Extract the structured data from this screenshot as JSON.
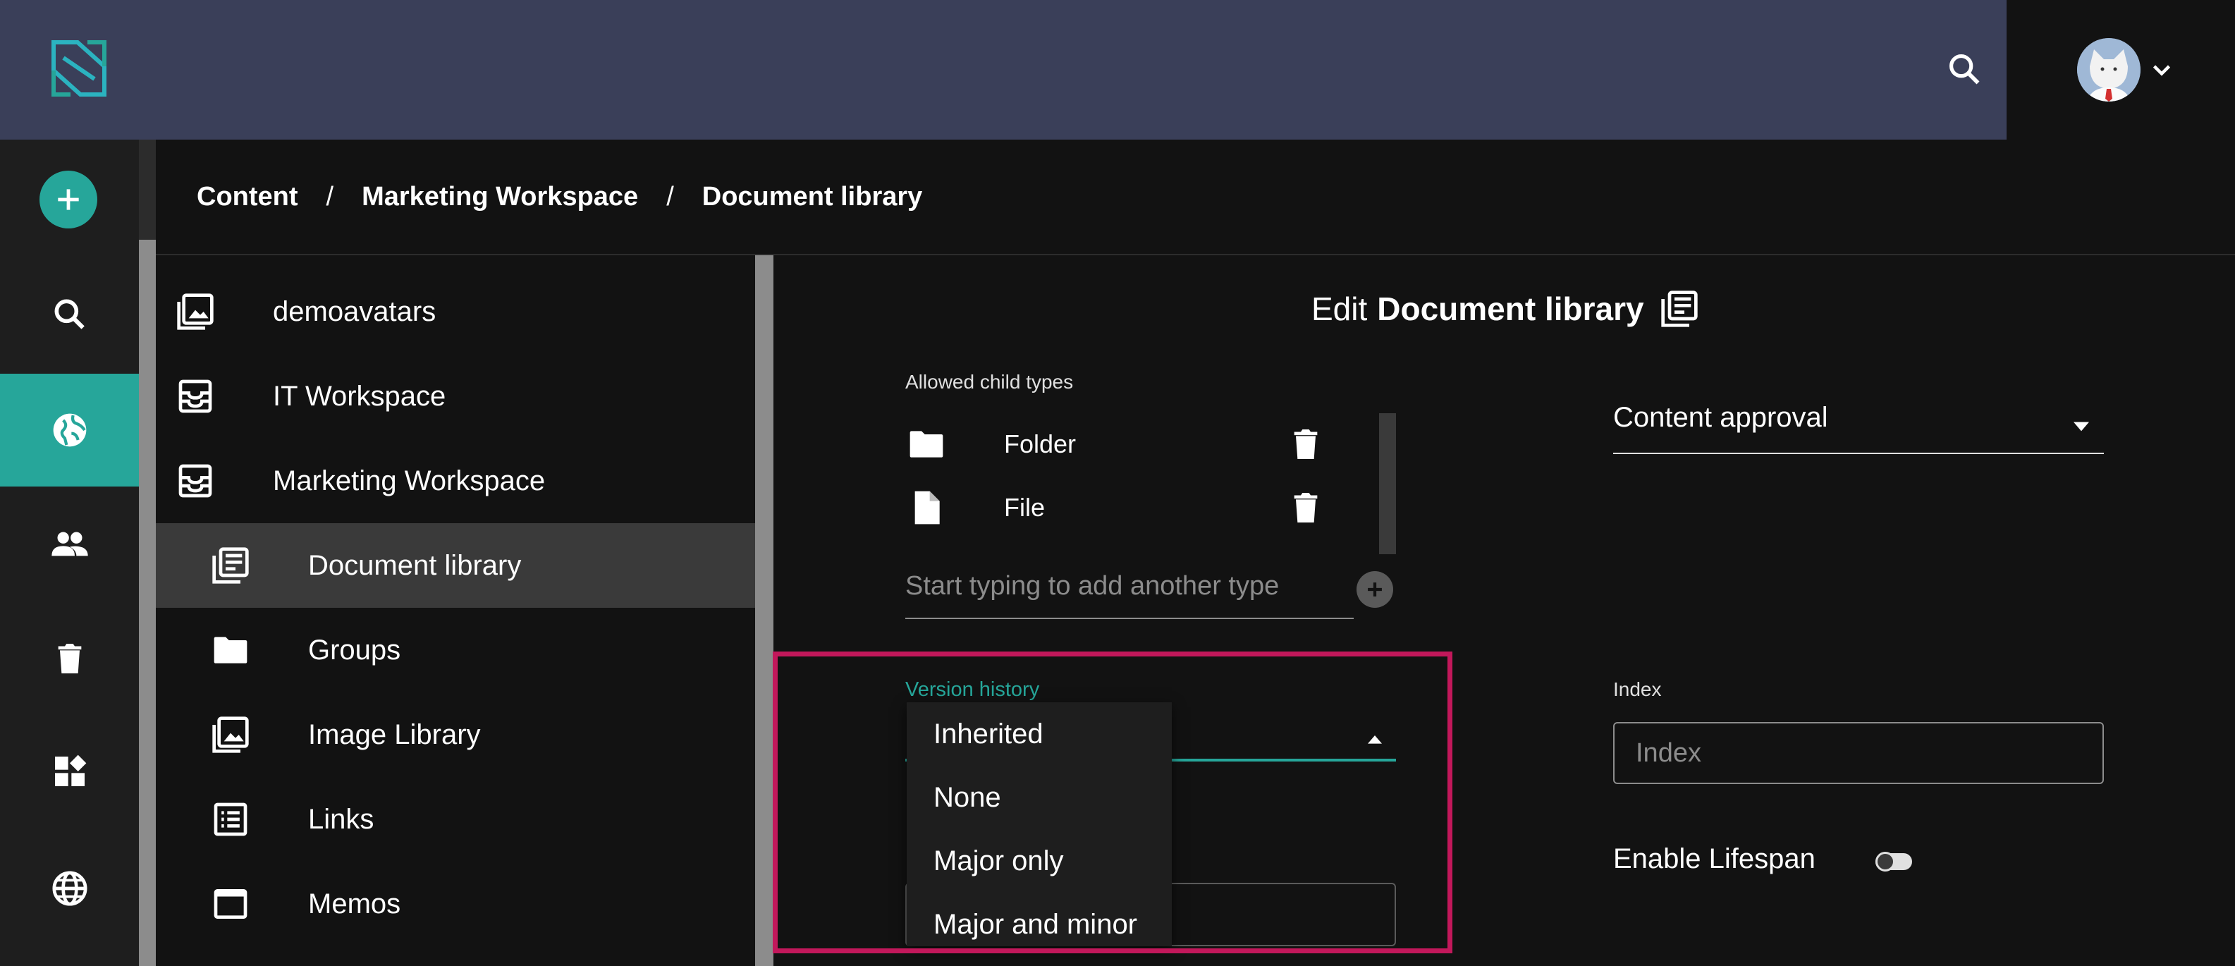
{
  "colors": {
    "topbar": "#3a3f59",
    "accent": "#26a69a",
    "highlight": "#c2185b",
    "background": "#121212"
  },
  "header": {
    "logo_icon": "sensenet-logo",
    "search_icon": "search-icon",
    "avatar_icon": "cat-avatar"
  },
  "rail": {
    "items": [
      {
        "icon": "add-icon"
      },
      {
        "icon": "search-icon"
      },
      {
        "icon": "globe-icon",
        "active": true
      },
      {
        "icon": "users-icon"
      },
      {
        "icon": "trash-icon"
      },
      {
        "icon": "widgets-icon"
      },
      {
        "icon": "language-icon"
      }
    ]
  },
  "breadcrumb": {
    "items": [
      "Content",
      "Marketing Workspace",
      "Document library"
    ],
    "separator": "/"
  },
  "tree": {
    "items": [
      {
        "label": "demoavatars",
        "icon": "image-library-icon"
      },
      {
        "label": "IT Workspace",
        "icon": "workspace-icon"
      },
      {
        "label": "Marketing Workspace",
        "icon": "workspace-icon"
      },
      {
        "label": "Document library",
        "icon": "document-library-icon",
        "selected": true
      },
      {
        "label": "Groups",
        "icon": "folder-icon"
      },
      {
        "label": "Image Library",
        "icon": "image-library-icon"
      },
      {
        "label": "Links",
        "icon": "list-icon"
      },
      {
        "label": "Memos",
        "icon": "memo-icon"
      }
    ]
  },
  "edit": {
    "title_prefix": "Edit",
    "title_name": "Document library",
    "allowed_child_types_label": "Allowed child types",
    "child_types": [
      {
        "label": "Folder",
        "icon": "folder-icon"
      },
      {
        "label": "File",
        "icon": "file-icon"
      }
    ],
    "add_type_placeholder": "Start typing to add another type",
    "version_history_label": "Version history",
    "version_options": [
      "Inherited",
      "None",
      "Major only",
      "Major and minor"
    ],
    "content_approval_value": "Content approval",
    "index_label": "Index",
    "index_placeholder": "Index",
    "enable_lifespan_label": "Enable Lifespan",
    "enable_lifespan_value": false
  }
}
